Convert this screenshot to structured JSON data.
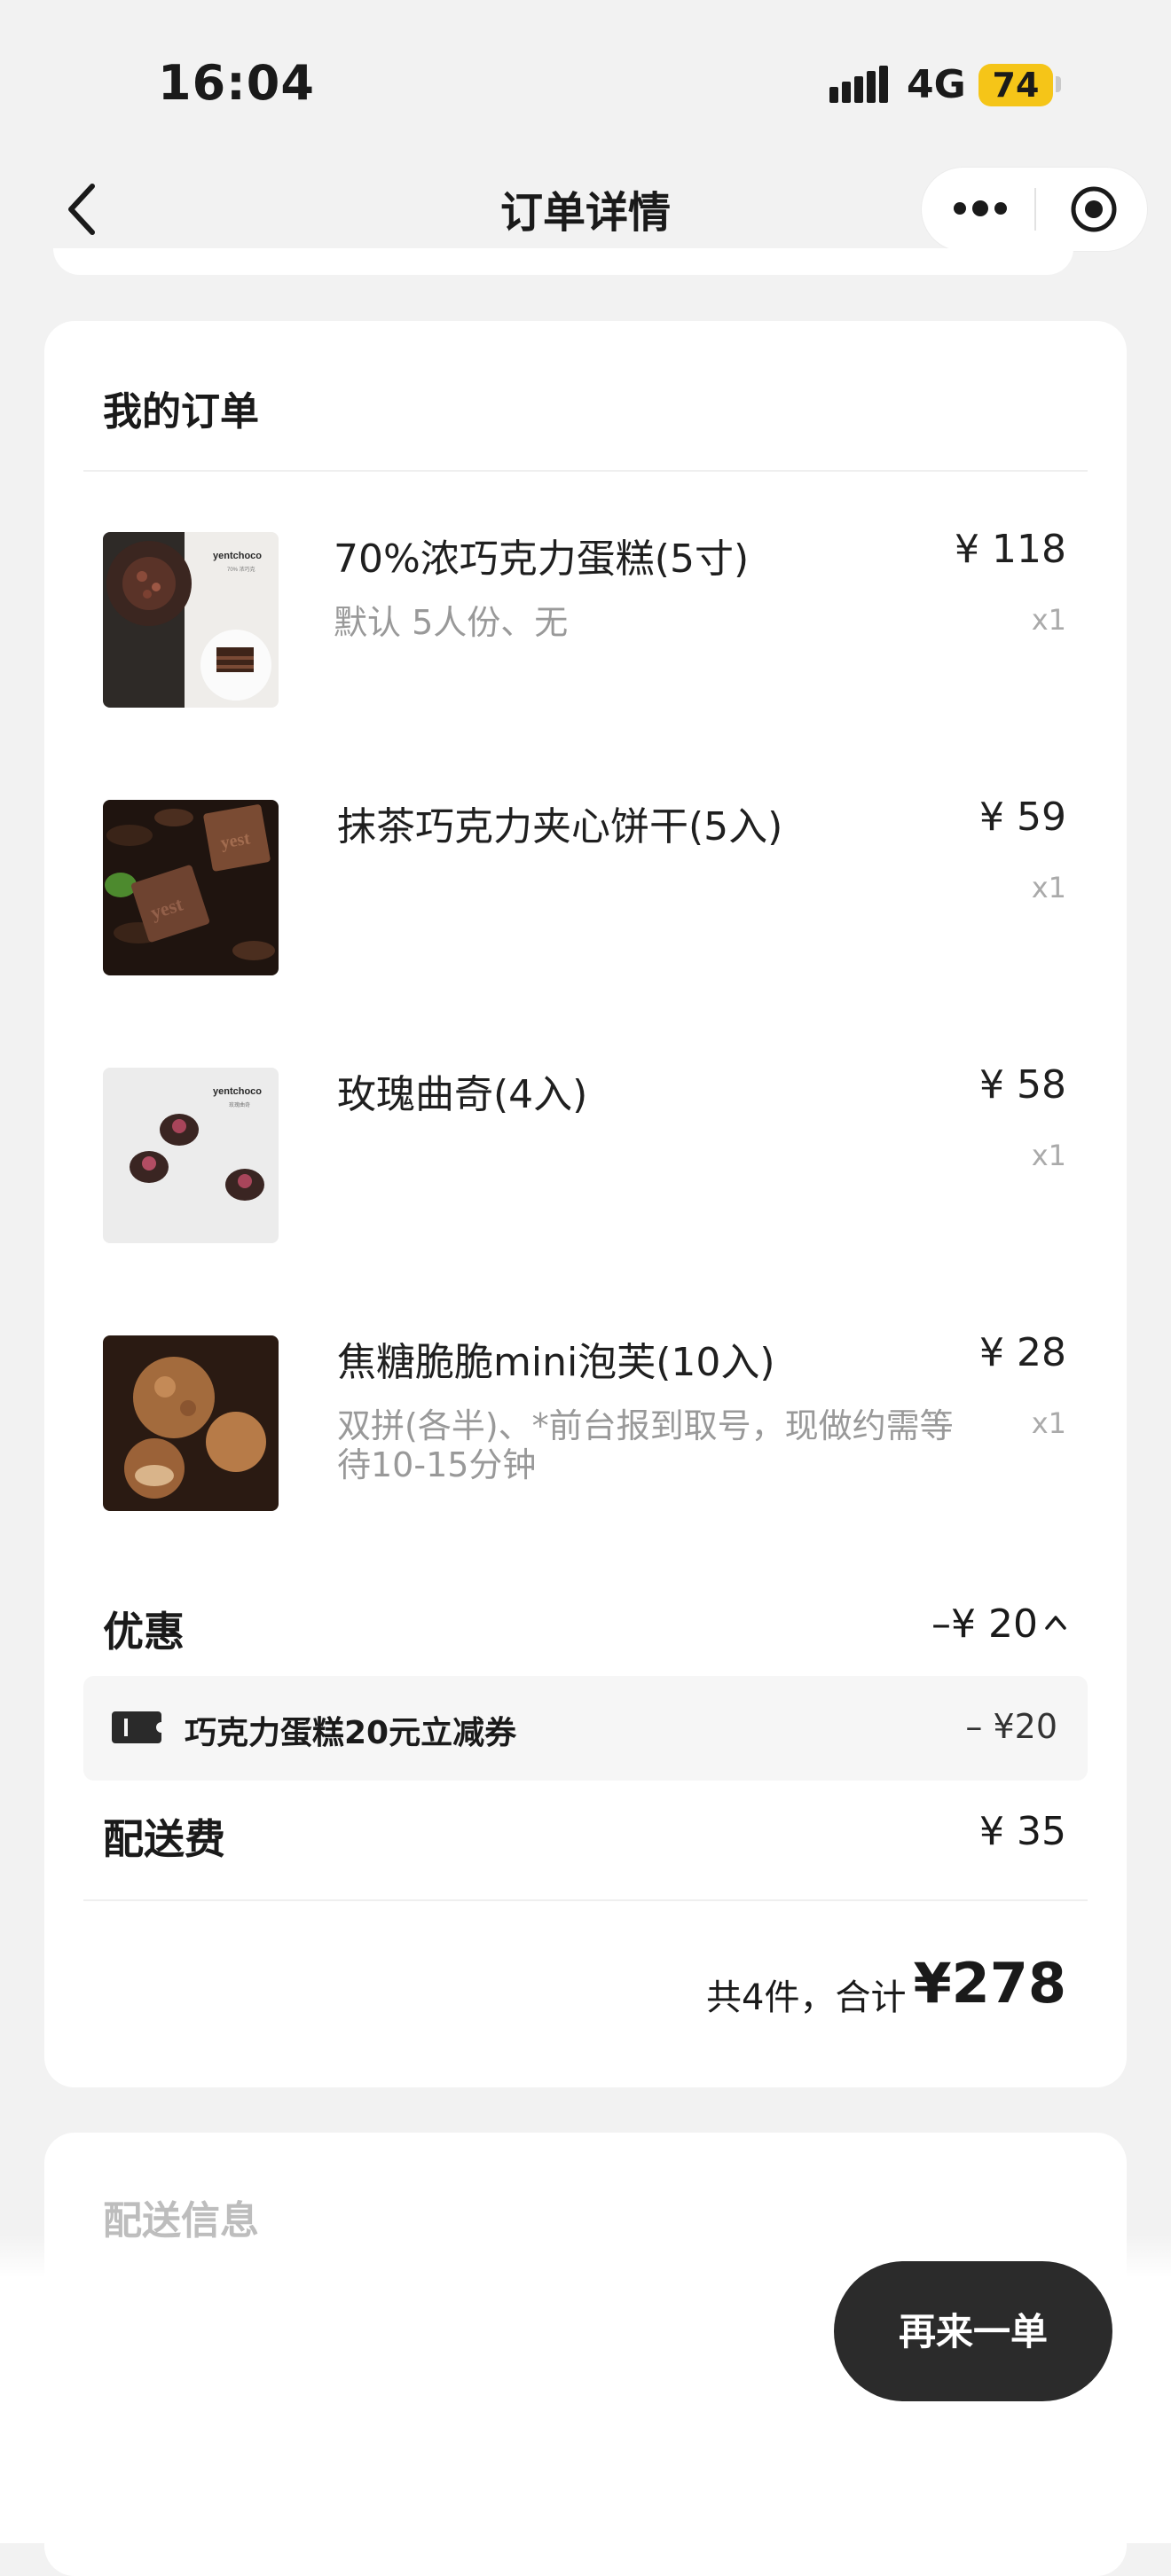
{
  "status_bar": {
    "time": "16:04",
    "network": "4G",
    "battery": "74"
  },
  "nav": {
    "title": "订单详情"
  },
  "order": {
    "section_title": "我的订单",
    "items": [
      {
        "name": "70%浓巧克力蛋糕(5寸)",
        "spec": "默认 5人份、无",
        "price": "¥ 118",
        "qty": "x1"
      },
      {
        "name": "抹茶巧克力夹心饼干(5入)",
        "spec": "",
        "price": "¥ 59",
        "qty": "x1"
      },
      {
        "name": "玫瑰曲奇(4入)",
        "spec": "",
        "price": "¥ 58",
        "qty": "x1"
      },
      {
        "name": "焦糖脆脆mini泡芙(10入)",
        "spec": "双拼(各半)、*前台报到取号，现做约需等待10-15分钟",
        "price": "¥ 28",
        "qty": "x1"
      }
    ],
    "thumb_text": {
      "brand": "yentchoco",
      "sub1": "70% 浓巧克",
      "sub2": "玫瑰曲奇",
      "cookie_mark": "yest"
    },
    "discount": {
      "label": "优惠",
      "value": "–¥ 20"
    },
    "coupon": {
      "name": "巧克力蛋糕20元立减券",
      "amount": "– ¥20"
    },
    "delivery_fee": {
      "label": "配送费",
      "value": "¥ 35"
    },
    "total": {
      "label": "共4件，合计",
      "value": "¥278"
    }
  },
  "delivery_section": {
    "title": "配送信息"
  },
  "actions": {
    "reorder": "再来一单"
  },
  "colors": {
    "accent_battery": "#f5c518",
    "button_bg": "#2b2b2b",
    "muted_text": "#999999"
  }
}
